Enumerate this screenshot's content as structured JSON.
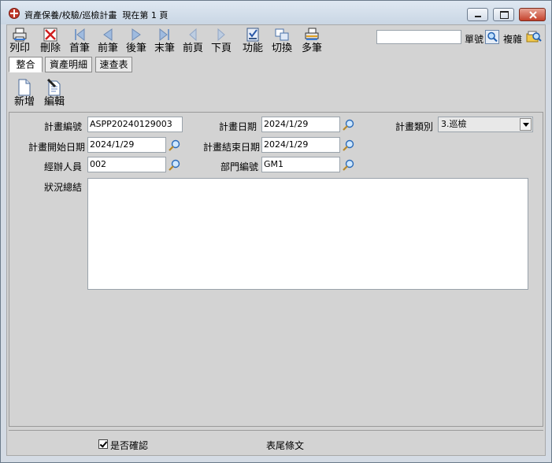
{
  "window": {
    "title": "資產保養/校驗/巡檢計畫",
    "page_status": "現在第 1 頁"
  },
  "toolbar": {
    "items": [
      {
        "label": "列印",
        "icon": "printer-icon"
      },
      {
        "label": "刪除",
        "icon": "delete-icon"
      },
      {
        "label": "首筆",
        "icon": "first-record-icon"
      },
      {
        "label": "前筆",
        "icon": "prev-record-icon"
      },
      {
        "label": "後筆",
        "icon": "next-record-icon"
      },
      {
        "label": "末筆",
        "icon": "last-record-icon"
      },
      {
        "label": "前頁",
        "icon": "prev-page-icon"
      },
      {
        "label": "下頁",
        "icon": "next-page-icon"
      },
      {
        "label": "功能",
        "icon": "function-icon"
      },
      {
        "label": "切換",
        "icon": "switch-icon"
      },
      {
        "label": "多筆",
        "icon": "multi-record-icon"
      }
    ],
    "search_value": "",
    "doc_no_label": "單號",
    "complex_label": "複雜"
  },
  "tabs": [
    {
      "label": "整合",
      "active": true
    },
    {
      "label": "資產明細",
      "active": false
    },
    {
      "label": "速查表",
      "active": false
    }
  ],
  "subtoolbar": {
    "new_label": "新增",
    "edit_label": "編輯"
  },
  "form": {
    "plan_no": {
      "label": "計畫編號",
      "value": "ASPP20240129003"
    },
    "plan_date": {
      "label": "計畫日期",
      "value": "2024/1/29"
    },
    "plan_type": {
      "label": "計畫類別",
      "value": "3.巡檢"
    },
    "start_date": {
      "label": "計畫開始日期",
      "value": "2024/1/29"
    },
    "end_date": {
      "label": "計畫結束日期",
      "value": "2024/1/29"
    },
    "handler": {
      "label": "經辦人員",
      "value": "002"
    },
    "dept_no": {
      "label": "部門編號",
      "value": "GM1"
    },
    "summary": {
      "label": "狀況總結",
      "value": ""
    }
  },
  "footer": {
    "confirm_label": "是否確認",
    "confirm_checked": true,
    "footer_text": "表尾條文"
  }
}
